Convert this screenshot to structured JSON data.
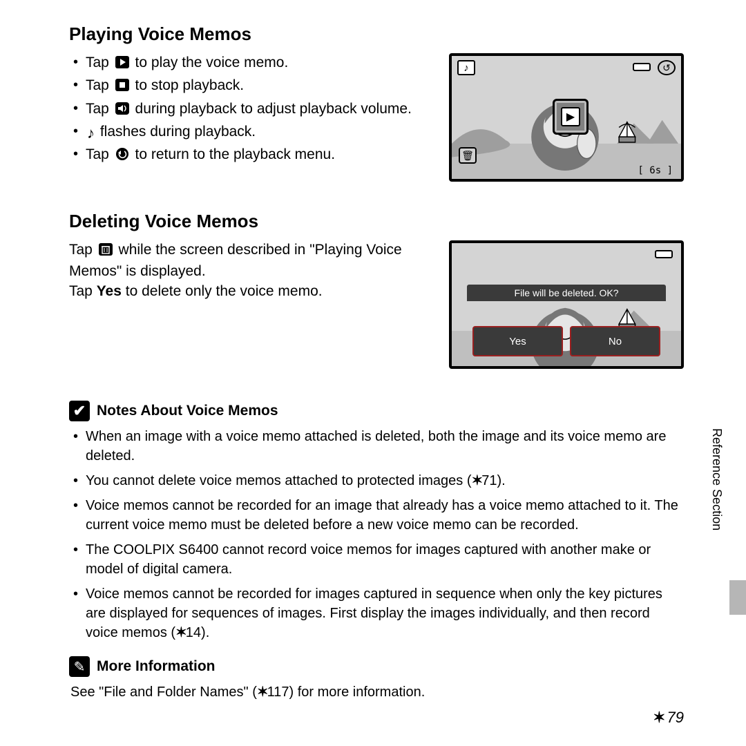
{
  "section_tab_label": "Reference Section",
  "page_number": "79",
  "playing": {
    "heading": "Playing Voice Memos",
    "items": [
      {
        "pre": "Tap ",
        "icon": "play-square",
        "post": " to play the voice memo."
      },
      {
        "pre": "Tap ",
        "icon": "stop-square",
        "post": " to stop playback."
      },
      {
        "pre": "Tap ",
        "icon": "volume",
        "post": " during playback to adjust playback volume."
      },
      {
        "pre": "",
        "icon": "music-note",
        "post": " flashes during playback."
      },
      {
        "pre": "Tap ",
        "icon": "return-circle",
        "post": " to return to the playback menu."
      }
    ],
    "screen": {
      "time_label": "6s"
    }
  },
  "deleting": {
    "heading": "Deleting Voice Memos",
    "line1_pre": "Tap ",
    "line1_post": " while the screen described in \"Playing Voice Memos\" is displayed.",
    "line2_pre": "Tap ",
    "line2_bold": "Yes",
    "line2_post": " to delete only the voice memo.",
    "dialog": {
      "message": "File will be deleted. OK?",
      "yes": "Yes",
      "no": "No"
    }
  },
  "notes": {
    "heading": "Notes About Voice Memos",
    "items": [
      "When an image with a voice memo attached is deleted, both the image and its voice memo are deleted.",
      "You cannot delete voice memos attached to protected images (🔗71).",
      "Voice memos cannot be recorded for an image that already has a voice memo attached to it. The current voice memo must be deleted before a new voice memo can be recorded.",
      "The COOLPIX S6400 cannot record voice memos for images captured with another make or model of digital camera.",
      "Voice memos cannot be recorded for images captured in sequence when only the key pictures are displayed for sequences of images. First display the images individually, and then record voice memos (🔗14)."
    ]
  },
  "more_info": {
    "heading": "More Information",
    "body_pre": "See \"File and Folder Names\" (",
    "body_ref": "🔗117",
    "body_post": ") for more information."
  }
}
